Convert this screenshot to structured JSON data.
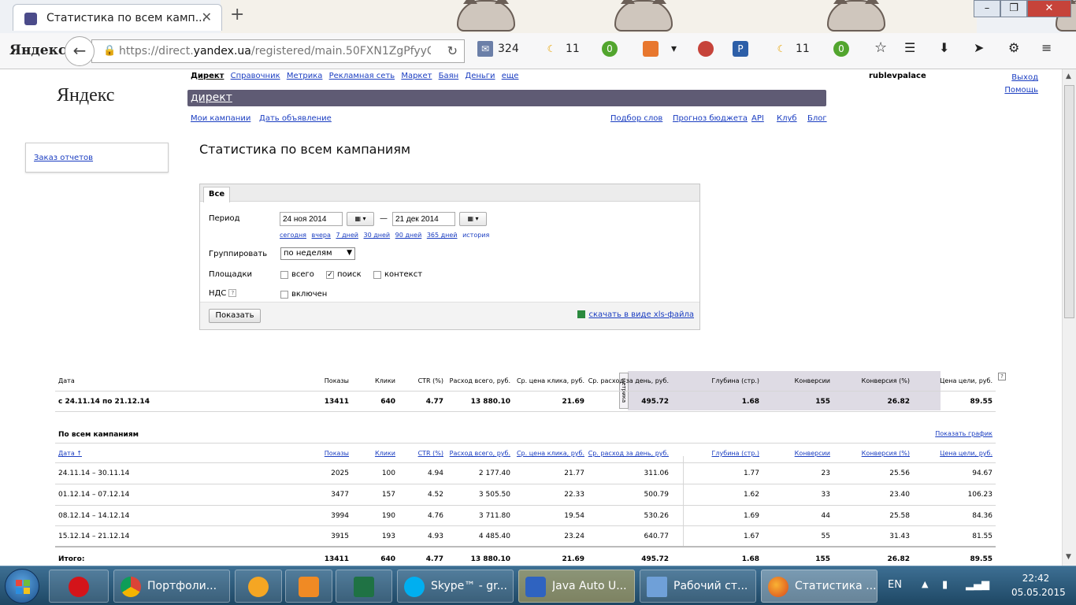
{
  "browser": {
    "tab_title": "Статистика по всем камп...",
    "url_prefix": "https://direct.",
    "url_domain": "yandex.ua",
    "url_path": "/registered/main.50FXN1ZgPfyyCE",
    "logo": "Яндекс",
    "mail_count": "324",
    "weather_1": "11",
    "badge_1": "0",
    "weather_2": "11",
    "badge_2": "0"
  },
  "header": {
    "brand": "Яндекс",
    "nav": [
      "Директ",
      "Справочник",
      "Метрика",
      "Рекламная сеть",
      "Маркет",
      "Баян",
      "Деньги",
      "еще"
    ],
    "section": "директ",
    "sub_left": [
      "Мои кампании",
      "Дать объявление"
    ],
    "sub_right": [
      "Подбор слов",
      "Прогноз бюджета",
      "API",
      "Клуб",
      "Блог"
    ],
    "user": "rublevpalace",
    "logout": "Выход",
    "help": "Помощь"
  },
  "sidebar": {
    "order_reports": "Заказ отчетов"
  },
  "page_title": "Статистика по всем кампаниям",
  "filters": {
    "tab": "Все",
    "period_label": "Период",
    "date_from": "24 ноя 2014",
    "date_sep": "—",
    "date_to": "21 дек 2014",
    "quick": [
      "сегодня",
      "вчера",
      "7 дней",
      "30 дней",
      "90 дней",
      "365 дней",
      "история"
    ],
    "group_label": "Группировать",
    "group_value": "по неделям",
    "platforms_label": "Площадки",
    "platforms": [
      {
        "label": "всего",
        "checked": false
      },
      {
        "label": "поиск",
        "checked": true
      },
      {
        "label": "контекст",
        "checked": false
      }
    ],
    "vat_label": "НДС",
    "vat_option": "включен",
    "show_button": "Показать",
    "xls_link": "скачать в виде xls-файла"
  },
  "summary": {
    "headers": [
      "Дата",
      "Показы",
      "Клики",
      "CTR (%)",
      "Расход всего, руб.",
      "Ср. цена клика, руб.",
      "Ср. расход за день, руб.",
      "Глубина (стр.)",
      "Конверсии",
      "Конверсия (%)",
      "Цена цели, руб."
    ],
    "metrika_label": "метрика",
    "row": [
      "с 24.11.14 по 21.12.14",
      "13411",
      "640",
      "4.77",
      "13 880.10",
      "21.69",
      "495.72",
      "1.68",
      "155",
      "26.82",
      "89.55"
    ]
  },
  "campaigns": {
    "title": "По всем кампаниям",
    "show_chart": "Показать график",
    "headers": [
      "Дата ↑",
      "Показы",
      "Клики",
      "CTR (%)",
      "Расход всего, руб.",
      "Ср. цена клика, руб.",
      "Ср. расход за день, руб.",
      "Глубина (стр.)",
      "Конверсии",
      "Конверсия (%)",
      "Цена цели, руб."
    ],
    "rows": [
      [
        "24.11.14 – 30.11.14",
        "2025",
        "100",
        "4.94",
        "2 177.40",
        "21.77",
        "311.06",
        "1.77",
        "23",
        "25.56",
        "94.67"
      ],
      [
        "01.12.14 – 07.12.14",
        "3477",
        "157",
        "4.52",
        "3 505.50",
        "22.33",
        "500.79",
        "1.62",
        "33",
        "23.40",
        "106.23"
      ],
      [
        "08.12.14 – 14.12.14",
        "3994",
        "190",
        "4.76",
        "3 711.80",
        "19.54",
        "530.26",
        "1.69",
        "44",
        "25.58",
        "84.36"
      ],
      [
        "15.12.14 – 21.12.14",
        "3915",
        "193",
        "4.93",
        "4 485.40",
        "23.24",
        "640.77",
        "1.67",
        "55",
        "31.43",
        "81.55"
      ]
    ],
    "total": [
      "Итого:",
      "13411",
      "640",
      "4.77",
      "13 880.10",
      "21.69",
      "495.72",
      "1.68",
      "155",
      "26.82",
      "89.55"
    ]
  },
  "taskbar": {
    "items": [
      "Портфоли...",
      "Skype™ - gr...",
      "Java Auto U...",
      "Рабочий ст...",
      "Статистика ..."
    ],
    "lang": "EN",
    "time": "22:42",
    "date": "05.05.2015"
  }
}
